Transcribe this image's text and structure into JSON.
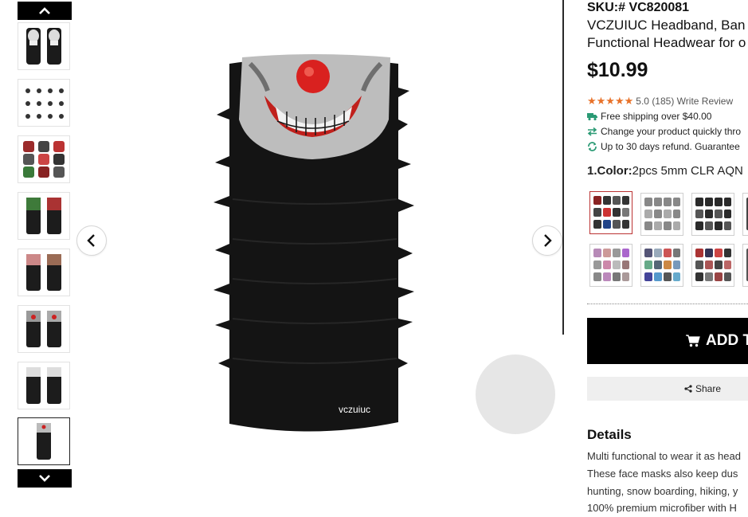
{
  "gallery": {
    "thumbnails": [
      {
        "icon": "skull-mask-pair"
      },
      {
        "icon": "mask-wearing-styles"
      },
      {
        "icon": "mask-grid-colorful"
      },
      {
        "icon": "mask-pair-green"
      },
      {
        "icon": "mask-pair-teeth"
      },
      {
        "icon": "mask-pair-clown"
      },
      {
        "icon": "mask-pair-skull"
      },
      {
        "icon": "mask-clown-selected"
      }
    ],
    "selected_index": 7,
    "product_brand_mark": "vczuiuc",
    "colors": {
      "tube": "#141414",
      "face": "#bdbdbd",
      "nose": "#d9211f",
      "mouth": "#c0201c"
    }
  },
  "product": {
    "sku": "SKU:# VC820081",
    "title_line1": "VCZUIUC Headband, Ban",
    "title_line2": "Functional Headwear for o",
    "price": "$10.99",
    "rating": "5.0",
    "review_count": "(185)",
    "write_review": "Write Review",
    "features": [
      "Free shipping over $40.00",
      "Change your product quickly thro",
      "Up to 30 days refund. Guarantee"
    ],
    "color_label": "1.Color:",
    "color_value": "2pcs 5mm CLR AQN",
    "add_button": "ADD T",
    "share_button": "Share",
    "details_title": "Details",
    "details_lines": [
      "Multi functional to wear it as head",
      "These face masks also keep dus",
      "hunting, snow boarding, hiking, y",
      "100% premium microfiber with H"
    ],
    "accent_color": "#e8722a",
    "feature_icon_color": "#2a9a74"
  }
}
